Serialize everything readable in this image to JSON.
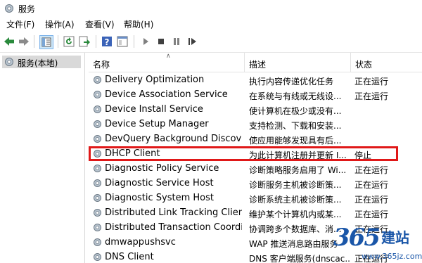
{
  "window": {
    "title": "服务"
  },
  "menu": [
    "文件(F)",
    "操作(A)",
    "查看(V)",
    "帮助(H)"
  ],
  "toolbar": {
    "buttons": [
      "back-icon",
      "forward-icon",
      "console-tree-icon",
      "refresh-icon",
      "export-icon",
      "help-icon",
      "properties-icon",
      "start-icon",
      "stop-icon",
      "pause-icon",
      "restart-icon"
    ]
  },
  "tree": {
    "item": "服务(本地)"
  },
  "columns": {
    "name": "名称",
    "desc": "描述",
    "status": "状态"
  },
  "services": [
    {
      "name": "Delivery Optimization",
      "desc": "执行内容传递优化任务",
      "status": "正在运行"
    },
    {
      "name": "Device Association Service",
      "desc": "在系统与有线或无线设...",
      "status": "正在运行"
    },
    {
      "name": "Device Install Service",
      "desc": "使计算机在极少或没有...",
      "status": ""
    },
    {
      "name": "Device Setup Manager",
      "desc": "支持检测、下载和安装...",
      "status": ""
    },
    {
      "name": "DevQuery Background Discover...",
      "desc": "使应用能够发现具有后...",
      "status": ""
    },
    {
      "name": "DHCP Client",
      "desc": "为此计算机注册并更新 I...",
      "status": "停止"
    },
    {
      "name": "Diagnostic Policy Service",
      "desc": "诊断策略服务启用了 Wi...",
      "status": "正在运行"
    },
    {
      "name": "Diagnostic Service Host",
      "desc": "诊断服务主机被诊断策...",
      "status": "正在运行"
    },
    {
      "name": "Diagnostic System Host",
      "desc": "诊断系统主机被诊断策...",
      "status": "正在运行"
    },
    {
      "name": "Distributed Link Tracking Client",
      "desc": "维护某个计算机内或某...",
      "status": "正在运行"
    },
    {
      "name": "Distributed Transaction Coordin...",
      "desc": "协调跨多个数据库、消...",
      "status": "正在运行"
    },
    {
      "name": "dmwappushsvc",
      "desc": "WAP 推送消息路由服务",
      "status": ""
    },
    {
      "name": "DNS Client",
      "desc": "DNS 客户端服务(dnscac...",
      "status": "正在运行"
    }
  ],
  "highlighted_row": 5,
  "highlight_color": "#e01818",
  "watermark": {
    "num": "365",
    "cn": "建站",
    "url": "www.365jz.com"
  }
}
